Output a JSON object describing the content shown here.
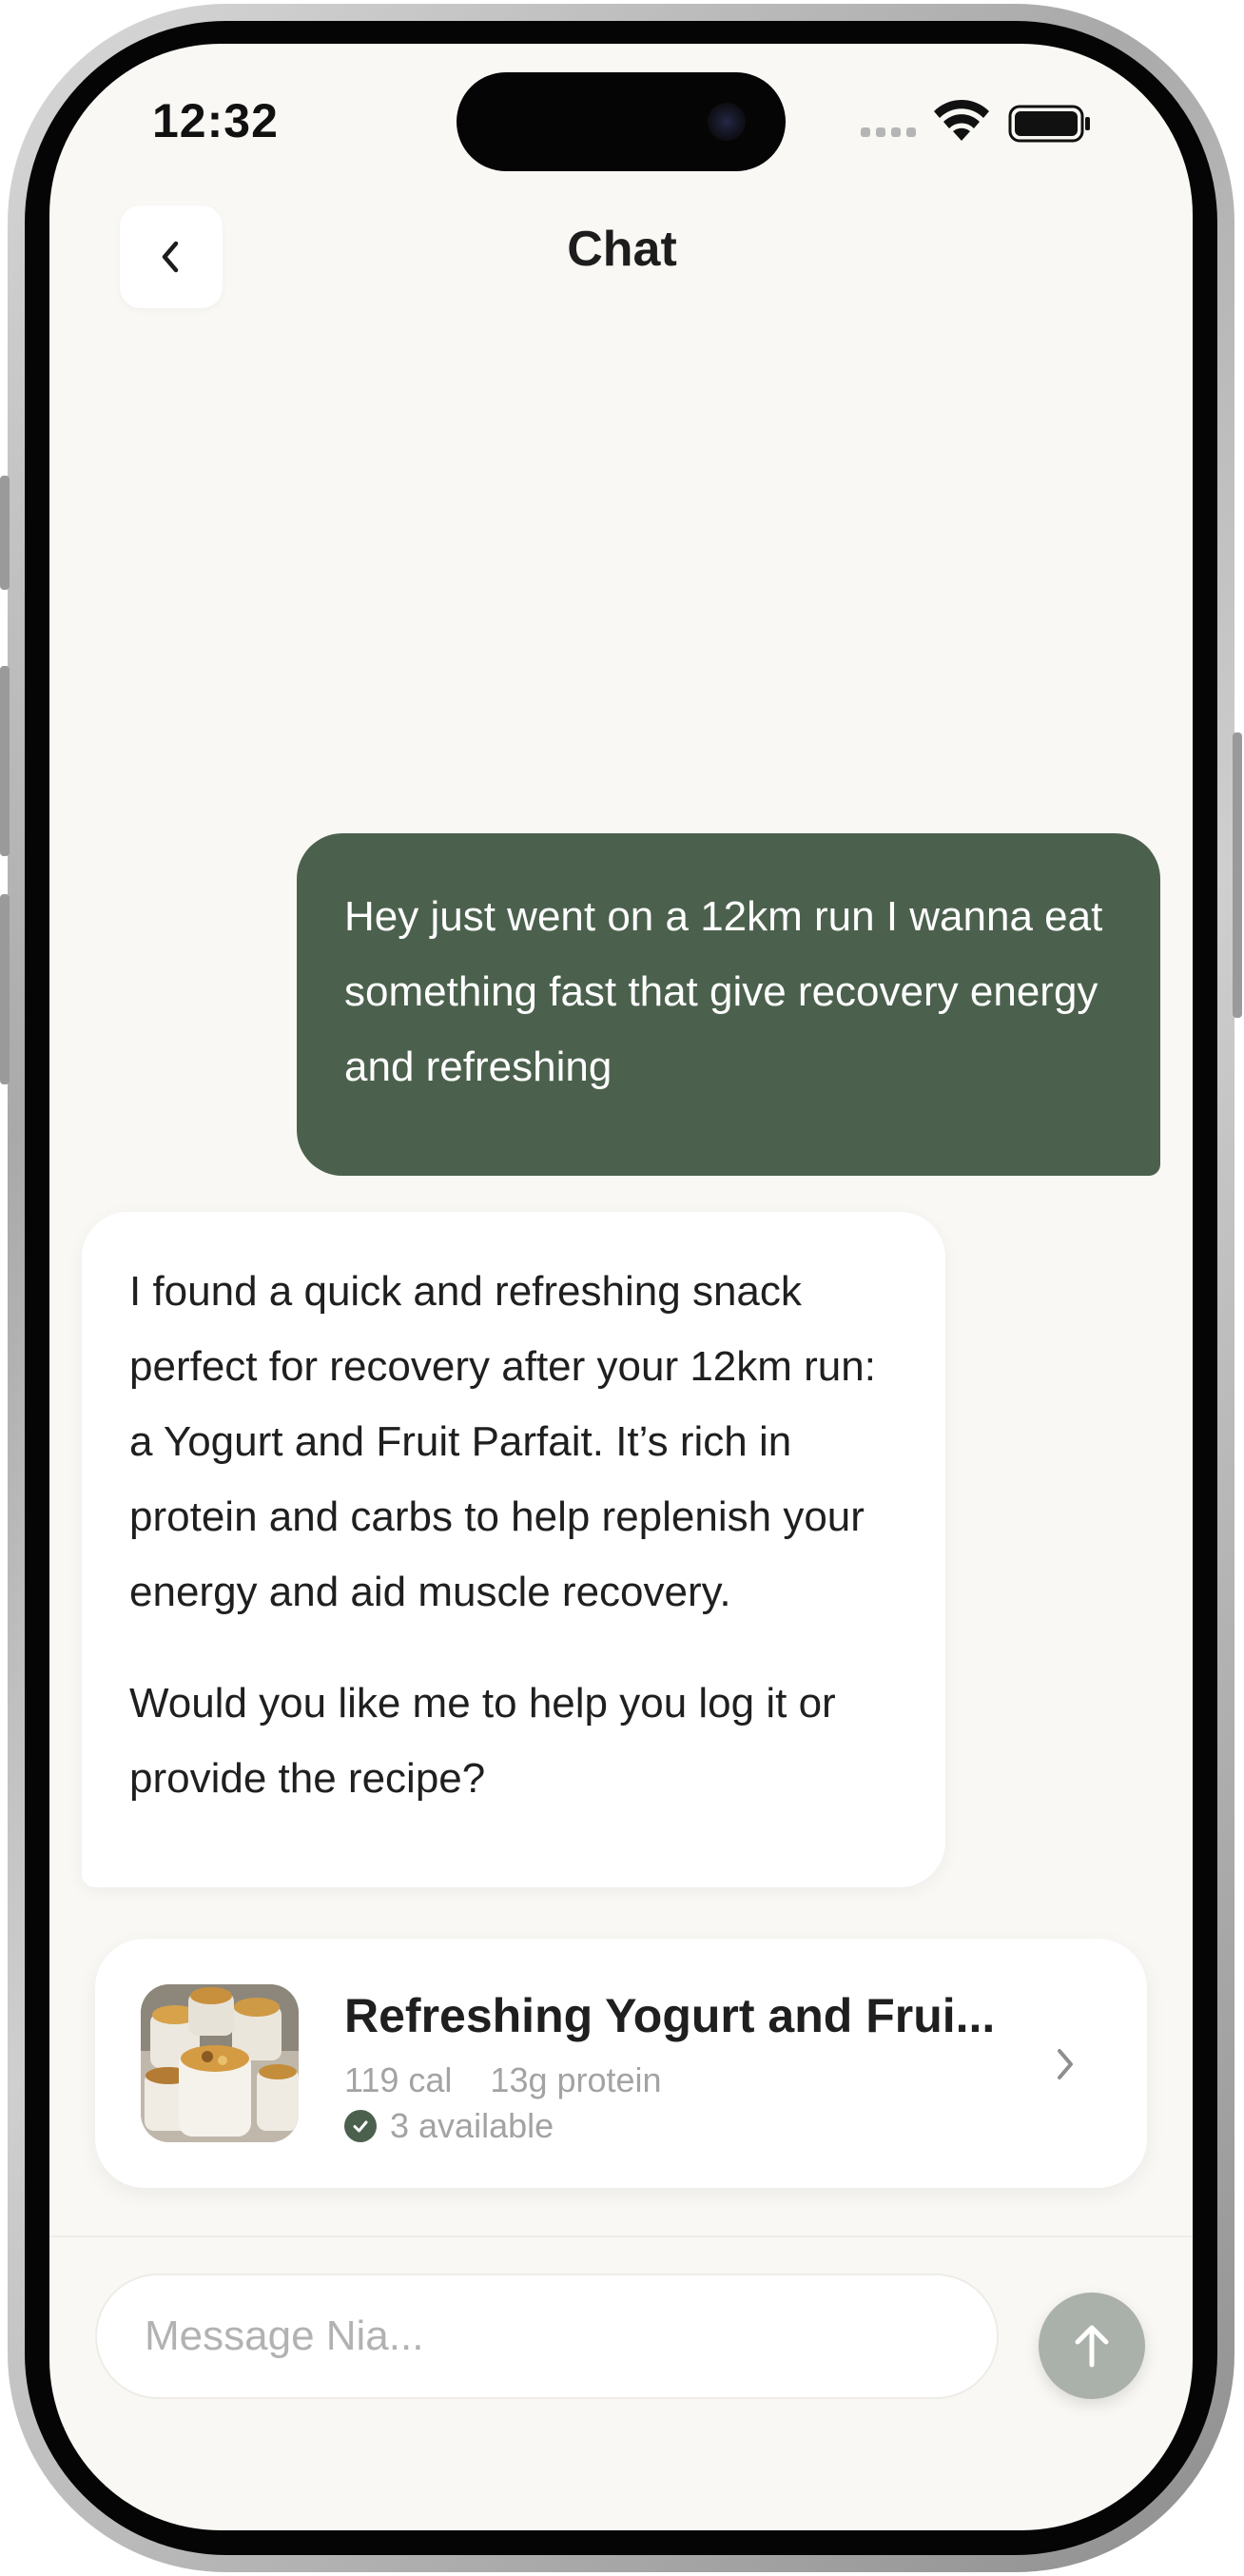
{
  "status_bar": {
    "time": "12:32"
  },
  "header": {
    "title": "Chat",
    "back_icon": "chevron-left-icon"
  },
  "messages": [
    {
      "role": "user",
      "text": "Hey just went on a 12km run I wanna eat something fast that give recovery energy and refreshing"
    },
    {
      "role": "assistant",
      "paragraphs": [
        "I found a quick and refreshing snack perfect for recovery after your 12km run: a Yogurt and Fruit Parfait. It’s rich in protein and carbs to help replenish your energy and aid muscle recovery.",
        "Would you like me to help you log it or provide the recipe?"
      ]
    }
  ],
  "recipe_card": {
    "title": "Refreshing Yogurt and Frui...",
    "calories": "119 cal",
    "protein": "13g protein",
    "availability": "3 available"
  },
  "composer": {
    "placeholder": "Message Nia...",
    "send_icon": "arrow-up-icon"
  },
  "colors": {
    "background": "#f9f8f4",
    "user_bubble": "#4b614d",
    "send_button": "#aab1aa"
  }
}
